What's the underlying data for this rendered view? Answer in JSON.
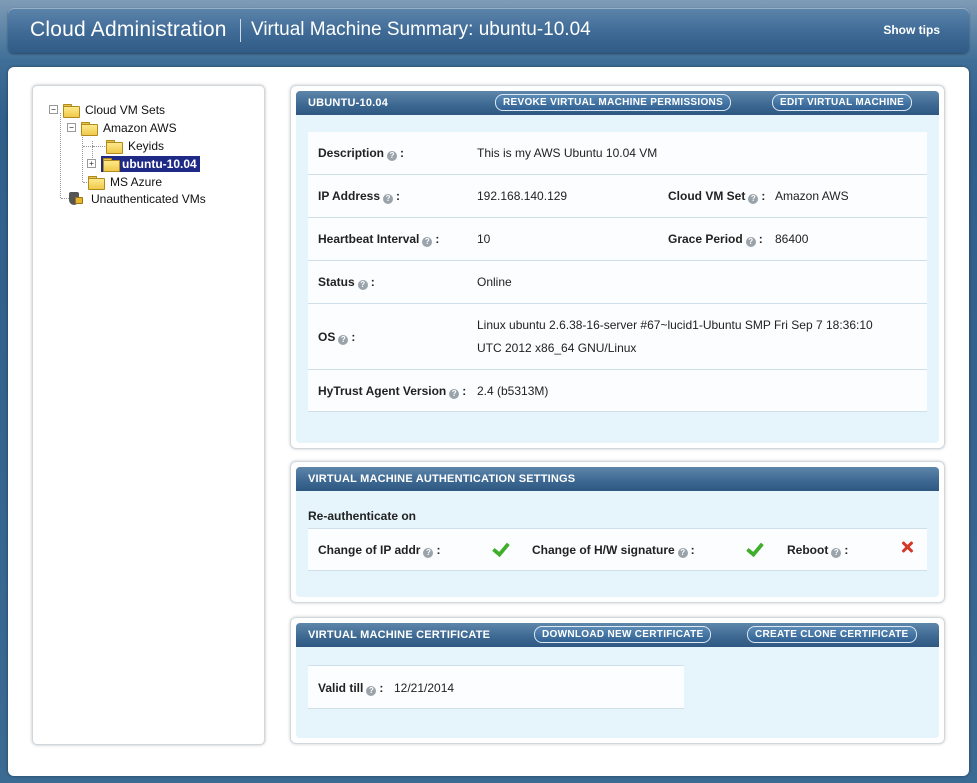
{
  "header": {
    "app_title": "Cloud Administration",
    "page_title": "Virtual Machine Summary: ubuntu-10.04",
    "show_tips": "Show tips"
  },
  "tree": {
    "cloud_vm_sets": "Cloud VM Sets",
    "amazon_aws": "Amazon AWS",
    "keyids": "Keyids",
    "ubuntu": "ubuntu-10.04",
    "ms_azure": "MS Azure",
    "unauthenticated": "Unauthenticated VMs",
    "expanded_symbol": "−",
    "collapsed_symbol": "+"
  },
  "summary": {
    "title": "UBUNTU-10.04",
    "revoke_button": "REVOKE VIRTUAL MACHINE PERMISSIONS",
    "edit_button": "EDIT VIRTUAL MACHINE",
    "description_label": "Description",
    "description_value": "This is my AWS Ubuntu 10.04 VM",
    "ip_label": "IP Address",
    "ip_value": "192.168.140.129",
    "vmset_label": "Cloud VM Set",
    "vmset_value": "Amazon AWS",
    "heartbeat_label": "Heartbeat Interval",
    "heartbeat_value": "10",
    "grace_label": "Grace Period",
    "grace_value": "86400",
    "status_label": "Status",
    "status_value": "Online",
    "os_label": "OS",
    "os_value_line1": "Linux ubuntu 2.6.38-16-server #67~lucid1-Ubuntu SMP Fri Sep 7 18:36:10",
    "os_value_line2": "UTC 2012 x86_64 GNU/Linux",
    "agent_label": "HyTrust Agent Version",
    "agent_value": "2.4 (b5313M)"
  },
  "auth": {
    "title": "VIRTUAL MACHINE AUTHENTICATION SETTINGS",
    "reauth_heading": "Re-authenticate on",
    "ip_change_label": "Change of IP addr",
    "ip_change_enabled": true,
    "hw_change_label": "Change of H/W signature",
    "hw_change_enabled": true,
    "reboot_label": "Reboot",
    "reboot_enabled": false
  },
  "certificate": {
    "title": "VIRTUAL MACHINE CERTIFICATE",
    "download_button": "DOWNLOAD NEW CERTIFICATE",
    "clone_button": "CREATE CLONE CERTIFICATE",
    "valid_label": "Valid till",
    "valid_value": "12/21/2014"
  },
  "help_symbol": "?",
  "colon": ":",
  "colors": {
    "header_blue": "#3e6a95",
    "selected_node": "#1e2a86",
    "check_green": "#3fae2a",
    "cross_red": "#d23a2a",
    "panel_bg": "#e6f4fb"
  }
}
